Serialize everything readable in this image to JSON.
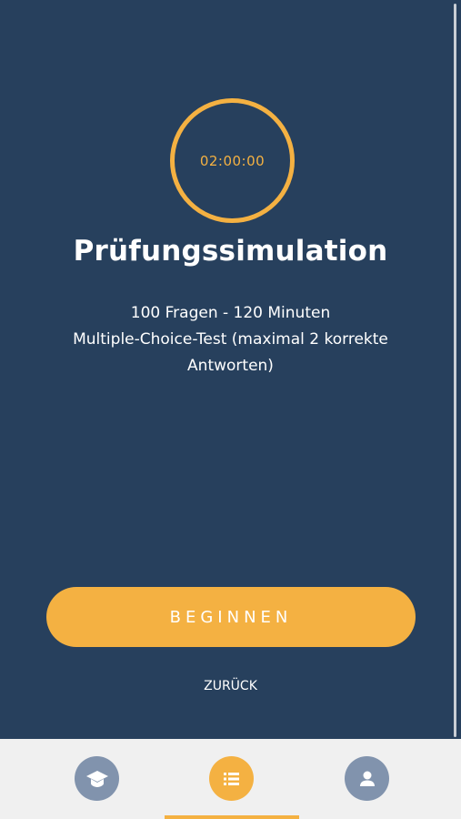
{
  "timer": {
    "value": "02:00:00"
  },
  "exam": {
    "title": "Prüfungssimulation",
    "description_line1": "100 Fragen - 120 Minuten",
    "description_line2": "Multiple-Choice-Test (maximal 2 korrekte Antworten)"
  },
  "actions": {
    "begin_label": "BEGINNEN",
    "back_label": "ZURÜCK"
  },
  "tabbar": {
    "items": [
      {
        "icon": "graduation-cap-icon",
        "active": false
      },
      {
        "icon": "list-icon",
        "active": true
      },
      {
        "icon": "user-icon",
        "active": false
      }
    ]
  },
  "colors": {
    "background": "#27405d",
    "accent": "#f4b142",
    "tab_inactive": "#8193ad",
    "tabbar_bg": "#f0f0f0"
  }
}
